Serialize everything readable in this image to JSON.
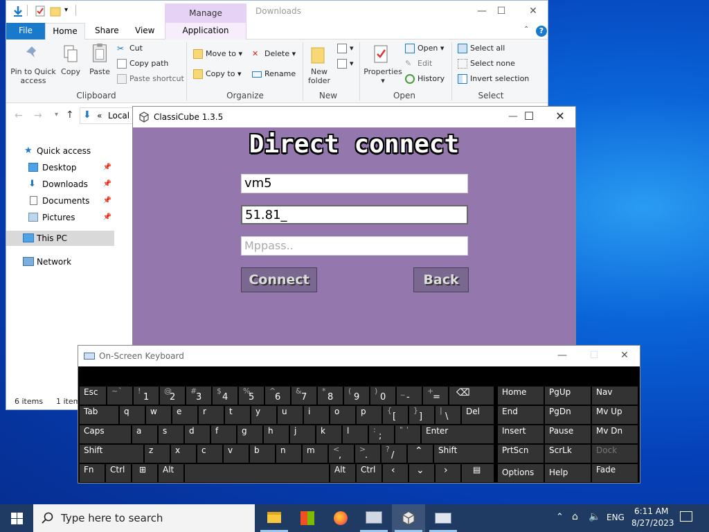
{
  "explorer": {
    "title": "Downloads",
    "context_tab": "Manage",
    "tabs": {
      "file": "File",
      "home": "Home",
      "share": "Share",
      "view": "View",
      "app_tools": "Application Tools"
    },
    "clipboard": {
      "pin": "Pin to Quick access",
      "copy": "Copy",
      "paste": "Paste",
      "cut": "Cut",
      "copy_path": "Copy path",
      "paste_shortcut": "Paste shortcut",
      "label": "Clipboard"
    },
    "organize": {
      "move_to": "Move to",
      "copy_to": "Copy to",
      "delete": "Delete",
      "rename": "Rename",
      "label": "Organize"
    },
    "new": {
      "new_folder": "New folder",
      "label": "New"
    },
    "open": {
      "properties": "Properties",
      "open": "Open",
      "edit": "Edit",
      "history": "History",
      "label": "Open"
    },
    "select": {
      "select_all": "Select all",
      "select_none": "Select none",
      "invert": "Invert selection",
      "label": "Select"
    },
    "address": "Local D",
    "nav": {
      "quick_access": "Quick access",
      "desktop": "Desktop",
      "downloads": "Downloads",
      "documents": "Documents",
      "pictures": "Pictures",
      "this_pc": "This PC",
      "network": "Network"
    },
    "status": {
      "items": "6 items",
      "selected": "1 item"
    }
  },
  "classicube": {
    "title": "ClassiCube 1.3.5",
    "heading": "Direct connect",
    "username": "vm5",
    "address": "51.81_",
    "mppass_placeholder": "Mppass..",
    "connect": "Connect",
    "back": "Back"
  },
  "osk": {
    "title": "On-Screen Keyboard",
    "keys": {
      "esc": "Esc",
      "tilde_top": "~",
      "tilde_bot": "`",
      "k1t": "!",
      "k1": "1",
      "k2t": "@",
      "k2": "2",
      "k3t": "#",
      "k3": "3",
      "k4t": "$",
      "k4": "4",
      "k5t": "%",
      "k5": "5",
      "k6t": "^",
      "k6": "6",
      "k7t": "&",
      "k7": "7",
      "k8t": "*",
      "k8": "8",
      "k9t": "(",
      "k9": "9",
      "k0t": ")",
      "k0": "0",
      "minus_t": "_",
      "minus": "-",
      "plus_t": "+",
      "plus": "=",
      "tab": "Tab",
      "q": "q",
      "w": "w",
      "e": "e",
      "r": "r",
      "t": "t",
      "y": "y",
      "u": "u",
      "i": "i",
      "o": "o",
      "p": "p",
      "lb_t": "{",
      "lb": "[",
      "rb_t": "}",
      "rb": "]",
      "bs_t": "|",
      "bs": "\\",
      "del": "Del",
      "caps": "Caps",
      "a": "a",
      "s": "s",
      "d": "d",
      "f": "f",
      "g": "g",
      "h": "h",
      "j": "j",
      "k": "k",
      "l": "l",
      "semi_t": ":",
      "semi": ";",
      "quote_t": "\"",
      "quote": "'",
      "enter": "Enter",
      "shift": "Shift",
      "z": "z",
      "x": "x",
      "c": "c",
      "v": "v",
      "b": "b",
      "n": "n",
      "m": "m",
      "comma_t": "<",
      "comma": ",",
      "period_t": ">",
      "period": ".",
      "slash_t": "?",
      "slash": "/",
      "fn": "Fn",
      "ctrl": "Ctrl",
      "alt": "Alt",
      "home": "Home",
      "pgup": "PgUp",
      "nav": "Nav",
      "end": "End",
      "pgdn": "PgDn",
      "mvup": "Mv Up",
      "insert": "Insert",
      "pause": "Pause",
      "mvdn": "Mv Dn",
      "prtscn": "PrtScn",
      "scrlk": "ScrLk",
      "dock": "Dock",
      "options": "Options",
      "help": "Help",
      "fade": "Fade"
    }
  },
  "taskbar": {
    "search_placeholder": "Type here to search",
    "lang": "ENG",
    "time": "6:11 AM",
    "date": "8/27/2023"
  }
}
